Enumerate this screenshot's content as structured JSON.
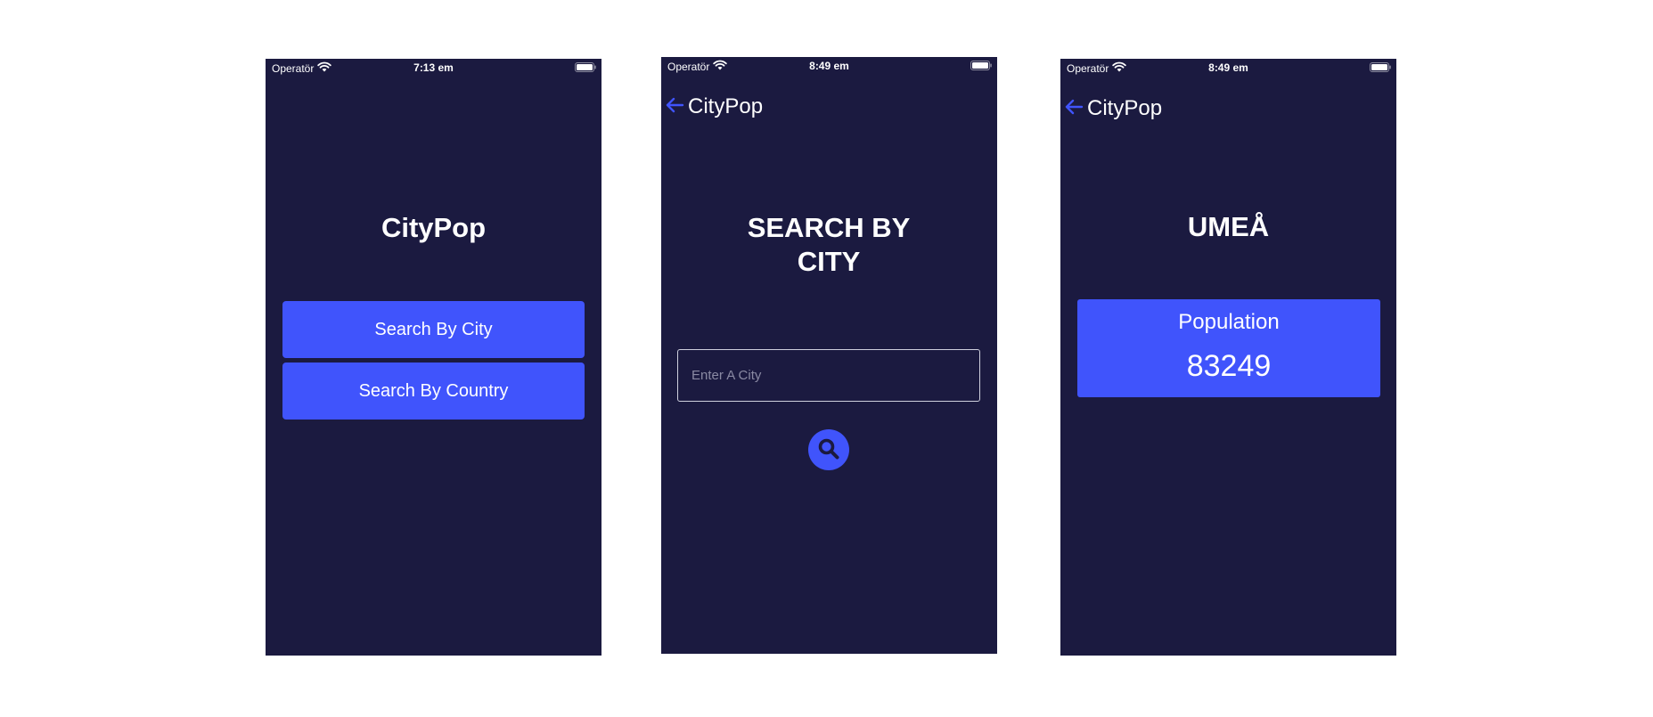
{
  "colors": {
    "background": "#1b1a40",
    "accent": "#4054fc",
    "text": "#ffffff"
  },
  "screens": {
    "home": {
      "status": {
        "carrier": "Operatör",
        "time": "7:13 em"
      },
      "title": "CityPop",
      "buttons": {
        "search_city": "Search By City",
        "search_country": "Search By Country"
      }
    },
    "search": {
      "status": {
        "carrier": "Operatör",
        "time": "8:49 em"
      },
      "nav_title": "CityPop",
      "title": "SEARCH BY CITY",
      "input": {
        "placeholder": "Enter A City",
        "value": ""
      },
      "search_icon": "search-icon"
    },
    "result": {
      "status": {
        "carrier": "Operatör",
        "time": "8:49 em"
      },
      "nav_title": "CityPop",
      "title": "UMEÅ",
      "population_label": "Population",
      "population_value": "83249"
    }
  },
  "icons": {
    "wifi": "wifi-icon",
    "battery": "battery-icon",
    "back": "back-arrow-icon",
    "search": "search-icon"
  }
}
